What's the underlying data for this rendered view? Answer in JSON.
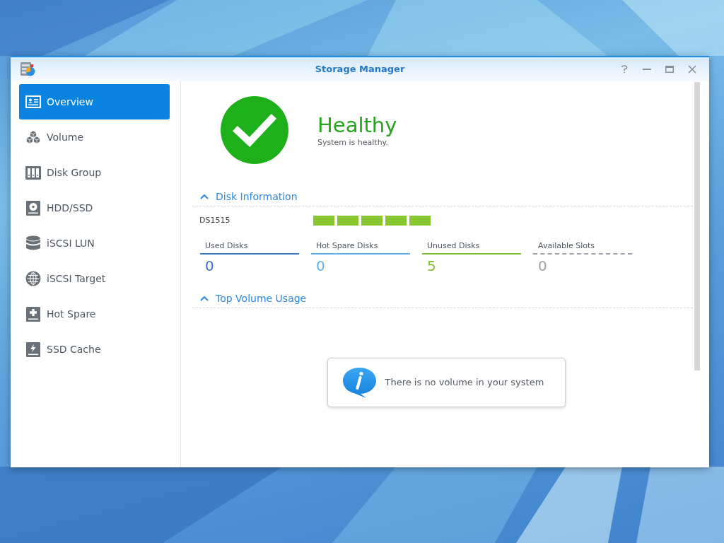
{
  "window": {
    "title": "Storage Manager"
  },
  "sidebar": {
    "items": [
      {
        "label": "Overview",
        "selected": true
      },
      {
        "label": "Volume",
        "selected": false
      },
      {
        "label": "Disk Group",
        "selected": false
      },
      {
        "label": "HDD/SSD",
        "selected": false
      },
      {
        "label": "iSCSI LUN",
        "selected": false
      },
      {
        "label": "iSCSI Target",
        "selected": false
      },
      {
        "label": "Hot Spare",
        "selected": false
      },
      {
        "label": "SSD Cache",
        "selected": false
      }
    ]
  },
  "health": {
    "kind": "healthy",
    "title": "Healthy",
    "message": "System is healthy."
  },
  "disk_information": {
    "title": "Disk Information",
    "expanded": true,
    "model": "DS1515",
    "slots": [
      {
        "color": "#86c62e"
      },
      {
        "color": "#86c62e"
      },
      {
        "color": "#86c62e"
      },
      {
        "color": "#86c62e"
      },
      {
        "color": "#86c62e"
      }
    ],
    "stats": [
      {
        "label": "Used Disks",
        "value": "0",
        "color": "#3478c6",
        "kind": "solid"
      },
      {
        "label": "Hot Spare Disks",
        "value": "0",
        "color": "#62b0ee",
        "kind": "solid"
      },
      {
        "label": "Unused Disks",
        "value": "5",
        "color": "#7dc22a",
        "kind": "solid"
      },
      {
        "label": "Available Slots",
        "value": "0",
        "color": "#9aa1a8",
        "kind": "dashed"
      }
    ]
  },
  "top_volume_usage": {
    "title": "Top Volume Usage",
    "expanded": true,
    "message": "There is no volume in your system"
  }
}
